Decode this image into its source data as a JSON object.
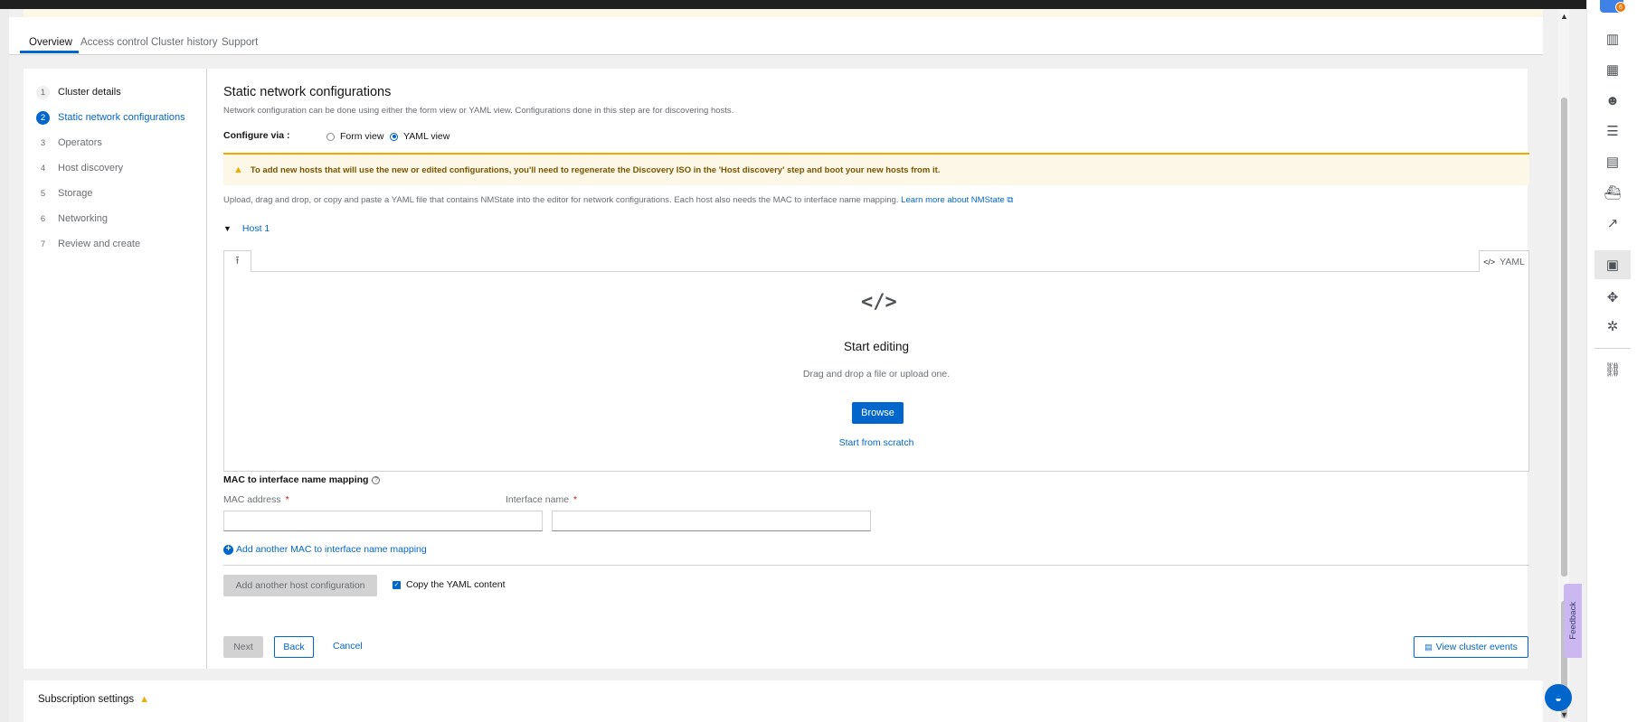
{
  "tabs": [
    {
      "label": "Overview"
    },
    {
      "label": "Access control"
    },
    {
      "label": "Cluster history"
    },
    {
      "label": "Support"
    }
  ],
  "wizard_nav": [
    {
      "num": "1",
      "label": "Cluster details"
    },
    {
      "num": "2",
      "label": "Static network configurations"
    },
    {
      "num": "3",
      "label": "Operators"
    },
    {
      "num": "4",
      "label": "Host discovery"
    },
    {
      "num": "5",
      "label": "Storage"
    },
    {
      "num": "6",
      "label": "Networking"
    },
    {
      "num": "7",
      "label": "Review and create"
    }
  ],
  "page": {
    "title": "Static network configurations",
    "description": "Network configuration can be done using either the form view or YAML view. Configurations done in this step are for discovering hosts.",
    "configure_via_label": "Configure via :",
    "radio_form": "Form view",
    "radio_yaml": "YAML view",
    "radio_selected": "YAML view",
    "warning": "To add new hosts that will use the new or edited configurations, you'll need to regenerate the Discovery ISO in the 'Host discovery' step and boot your new hosts from it.",
    "upload_desc": "Upload, drag and drop, or copy and paste a YAML file that contains NMState into the editor for network configurations. Each host also needs the MAC to interface name mapping. ",
    "learn_more": "Learn more about NMState"
  },
  "host": {
    "label": "Host 1",
    "editor_lang": "YAML",
    "start_editing": "Start editing",
    "drag_text": "Drag and drop a file or upload one.",
    "browse": "Browse",
    "start_scratch": "Start from scratch"
  },
  "mac_mapping": {
    "title": "MAC to interface name mapping",
    "mac_label": "MAC address",
    "interface_label": "Interface name",
    "required_mark": "*",
    "mac_value": "",
    "interface_value": "",
    "add_link": "Add another MAC to interface name mapping"
  },
  "footer": {
    "add_host": "Add another host configuration",
    "copy_yaml": "Copy the YAML content",
    "copy_yaml_checked": true,
    "next": "Next",
    "back": "Back",
    "cancel": "Cancel",
    "view_events": "View cluster events"
  },
  "subscription": {
    "title": "Subscription settings"
  },
  "feedback": "Feedback",
  "right_rail": {
    "badge": "6",
    "icons": [
      "columns-icon",
      "apps-grid-icon",
      "users-group-icon",
      "database-icon",
      "table-icon",
      "ship-icon",
      "trend-chart-icon",
      "monitor-check-icon",
      "puzzle-icon",
      "settings-cog-icon",
      "link-icon"
    ]
  },
  "colors": {
    "accent": "#0066cc",
    "warning": "#f0ab00",
    "feedback": "#cbb8f0"
  }
}
